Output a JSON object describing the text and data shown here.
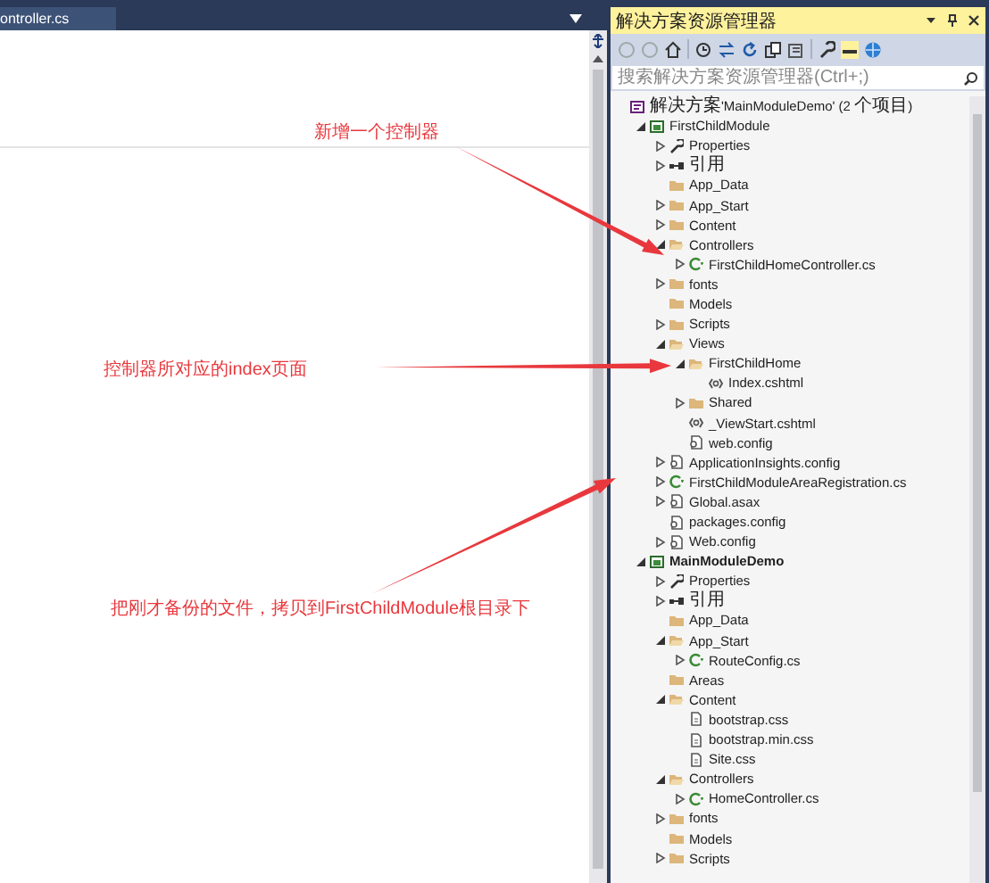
{
  "editor": {
    "tab": {
      "label": "ontroller.cs"
    }
  },
  "annotations": [
    {
      "text": "新增一个控制器"
    },
    {
      "text": "控制器所对应的index页面"
    },
    {
      "text": "把刚才备份的文件，拷贝到FirstChildModule根目录下"
    }
  ],
  "solution_explorer": {
    "title": "解决方案资源管理器",
    "search": {
      "placeholder": "搜索解决方案资源管理器(Ctrl+;)"
    },
    "tree": [
      {
        "label": "解决方案'MainModuleDemo' (2 个项目)",
        "kind": "solution",
        "children": [
          {
            "label": "FirstChildModule",
            "kind": "project",
            "startup": false,
            "expanded": true,
            "children": [
              {
                "label": "Properties",
                "kind": "wrench",
                "expanded": false
              },
              {
                "label": "引用",
                "kind": "references",
                "expanded": false
              },
              {
                "label": "App_Data",
                "kind": "folder"
              },
              {
                "label": "App_Start",
                "kind": "folder",
                "expanded": false
              },
              {
                "label": "Content",
                "kind": "folder",
                "expanded": false
              },
              {
                "label": "Controllers",
                "kind": "folder",
                "expanded": true,
                "children": [
                  {
                    "label": "FirstChildHomeController.cs",
                    "kind": "cs",
                    "expanded": false
                  }
                ]
              },
              {
                "label": "fonts",
                "kind": "folder",
                "expanded": false
              },
              {
                "label": "Models",
                "kind": "folder"
              },
              {
                "label": "Scripts",
                "kind": "folder",
                "expanded": false
              },
              {
                "label": "Views",
                "kind": "folder",
                "expanded": true,
                "children": [
                  {
                    "label": "FirstChildHome",
                    "kind": "folder",
                    "expanded": true,
                    "children": [
                      {
                        "label": "Index.cshtml",
                        "kind": "cshtml"
                      }
                    ]
                  },
                  {
                    "label": "Shared",
                    "kind": "folder",
                    "expanded": false
                  },
                  {
                    "label": "_ViewStart.cshtml",
                    "kind": "cshtml"
                  },
                  {
                    "label": "web.config",
                    "kind": "config"
                  }
                ]
              },
              {
                "label": "ApplicationInsights.config",
                "kind": "config",
                "expanded": false
              },
              {
                "label": "FirstChildModuleAreaRegistration.cs",
                "kind": "cs",
                "expanded": false
              },
              {
                "label": "Global.asax",
                "kind": "config",
                "expanded": false
              },
              {
                "label": "packages.config",
                "kind": "config"
              },
              {
                "label": "Web.config",
                "kind": "config",
                "expanded": false
              }
            ]
          },
          {
            "label": "MainModuleDemo",
            "kind": "project",
            "startup": true,
            "expanded": true,
            "children": [
              {
                "label": "Properties",
                "kind": "wrench",
                "expanded": false
              },
              {
                "label": "引用",
                "kind": "references",
                "expanded": false
              },
              {
                "label": "App_Data",
                "kind": "folder"
              },
              {
                "label": "App_Start",
                "kind": "folder",
                "expanded": true,
                "children": [
                  {
                    "label": "RouteConfig.cs",
                    "kind": "cs",
                    "expanded": false
                  }
                ]
              },
              {
                "label": "Areas",
                "kind": "folder"
              },
              {
                "label": "Content",
                "kind": "folder",
                "expanded": true,
                "children": [
                  {
                    "label": "bootstrap.css",
                    "kind": "file"
                  },
                  {
                    "label": "bootstrap.min.css",
                    "kind": "file"
                  },
                  {
                    "label": "Site.css",
                    "kind": "file"
                  }
                ]
              },
              {
                "label": "Controllers",
                "kind": "folder",
                "expanded": true,
                "children": [
                  {
                    "label": "HomeController.cs",
                    "kind": "cs",
                    "expanded": false
                  }
                ]
              },
              {
                "label": "fonts",
                "kind": "folder",
                "expanded": false
              },
              {
                "label": "Models",
                "kind": "folder"
              },
              {
                "label": "Scripts",
                "kind": "folder",
                "expanded": false
              }
            ]
          }
        ]
      }
    ]
  }
}
